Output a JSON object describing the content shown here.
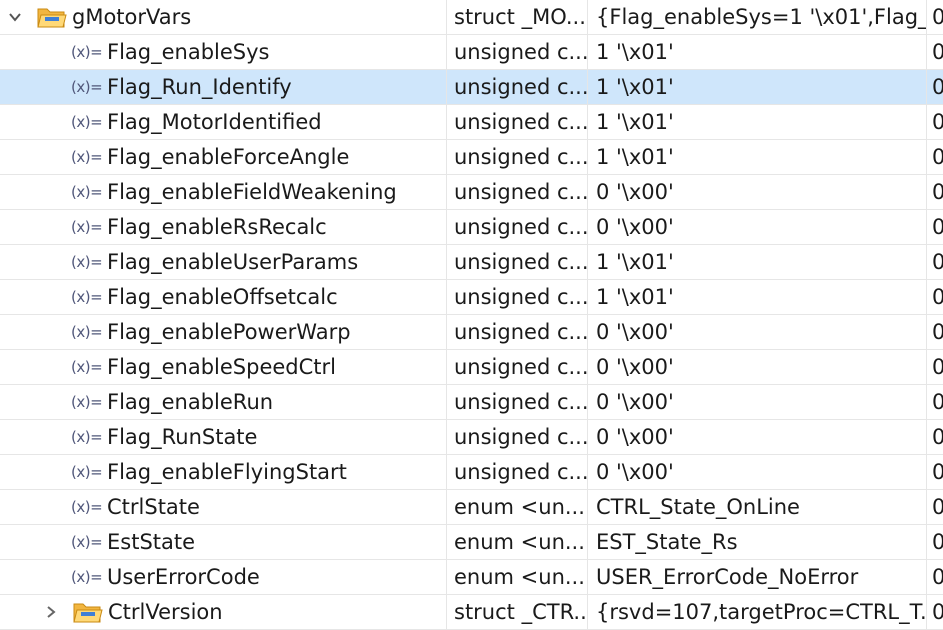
{
  "rows": [
    {
      "name": "gMotorVars",
      "type": "struct _MO...",
      "value": "{Flag_enableSys=1 '\\x01',Flag_...",
      "addr": "0"
    },
    {
      "name": "Flag_enableSys",
      "type": "unsigned c...",
      "value": "1 '\\x01'",
      "addr": "0"
    },
    {
      "name": "Flag_Run_Identify",
      "type": "unsigned c...",
      "value": "1 '\\x01'",
      "addr": "0"
    },
    {
      "name": "Flag_MotorIdentified",
      "type": "unsigned c...",
      "value": "1 '\\x01'",
      "addr": "0"
    },
    {
      "name": "Flag_enableForceAngle",
      "type": "unsigned c...",
      "value": "1 '\\x01'",
      "addr": "0"
    },
    {
      "name": "Flag_enableFieldWeakening",
      "type": "unsigned c...",
      "value": "0 '\\x00'",
      "addr": "0"
    },
    {
      "name": "Flag_enableRsRecalc",
      "type": "unsigned c...",
      "value": "0 '\\x00'",
      "addr": "0"
    },
    {
      "name": "Flag_enableUserParams",
      "type": "unsigned c...",
      "value": "1 '\\x01'",
      "addr": "0"
    },
    {
      "name": "Flag_enableOffsetcalc",
      "type": "unsigned c...",
      "value": "1 '\\x01'",
      "addr": "0"
    },
    {
      "name": "Flag_enablePowerWarp",
      "type": "unsigned c...",
      "value": "0 '\\x00'",
      "addr": "0"
    },
    {
      "name": "Flag_enableSpeedCtrl",
      "type": "unsigned c...",
      "value": "0 '\\x00'",
      "addr": "0"
    },
    {
      "name": "Flag_enableRun",
      "type": "unsigned c...",
      "value": "0 '\\x00'",
      "addr": "0"
    },
    {
      "name": "Flag_RunState",
      "type": "unsigned c...",
      "value": "0 '\\x00'",
      "addr": "0"
    },
    {
      "name": "Flag_enableFlyingStart",
      "type": "unsigned c...",
      "value": "0 '\\x00'",
      "addr": "0"
    },
    {
      "name": "CtrlState",
      "type": "enum <un...",
      "value": "CTRL_State_OnLine",
      "addr": "0"
    },
    {
      "name": "EstState",
      "type": "enum <un...",
      "value": "EST_State_Rs",
      "addr": "0"
    },
    {
      "name": "UserErrorCode",
      "type": "enum <un...",
      "value": "USER_ErrorCode_NoError",
      "addr": "0"
    },
    {
      "name": "CtrlVersion",
      "type": "struct _CTR...",
      "value": "{rsvd=107,targetProc=CTRL_T...",
      "addr": "0"
    }
  ],
  "icons": {
    "variable_icon_text": "(x)=",
    "expanded": "chevron-down-icon",
    "collapsed": "chevron-right-icon",
    "struct": "folder-icon"
  },
  "colors": {
    "selected_row": "#cfe6fb",
    "folder": "#f2b640",
    "folder_accent": "#3f7fd6"
  }
}
